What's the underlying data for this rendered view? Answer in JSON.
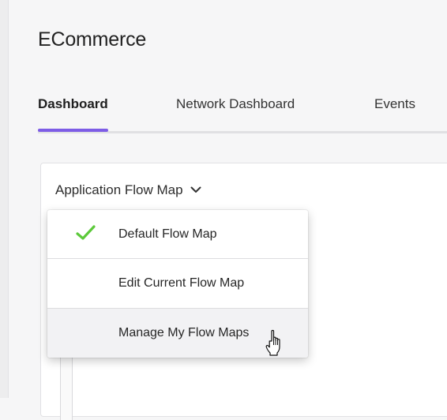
{
  "app": {
    "title": "ECommerce"
  },
  "tabs": [
    {
      "label": "Dashboard",
      "active": true
    },
    {
      "label": "Network Dashboard",
      "active": false
    },
    {
      "label": "Events",
      "active": false
    }
  ],
  "panel": {
    "dropdown_label": "Application Flow Map"
  },
  "menu": {
    "items": [
      {
        "label": "Default Flow Map",
        "selected": true
      },
      {
        "label": "Edit Current Flow Map",
        "selected": false
      },
      {
        "label": "Manage My Flow Maps",
        "selected": false,
        "hovered": true
      }
    ]
  },
  "colors": {
    "accent": "#7d5ce6",
    "check": "#5cc93a"
  },
  "icons": {
    "dropdown": "chevron-down-icon",
    "selected": "checkmark-icon",
    "cursor": "hand-pointer-icon"
  }
}
